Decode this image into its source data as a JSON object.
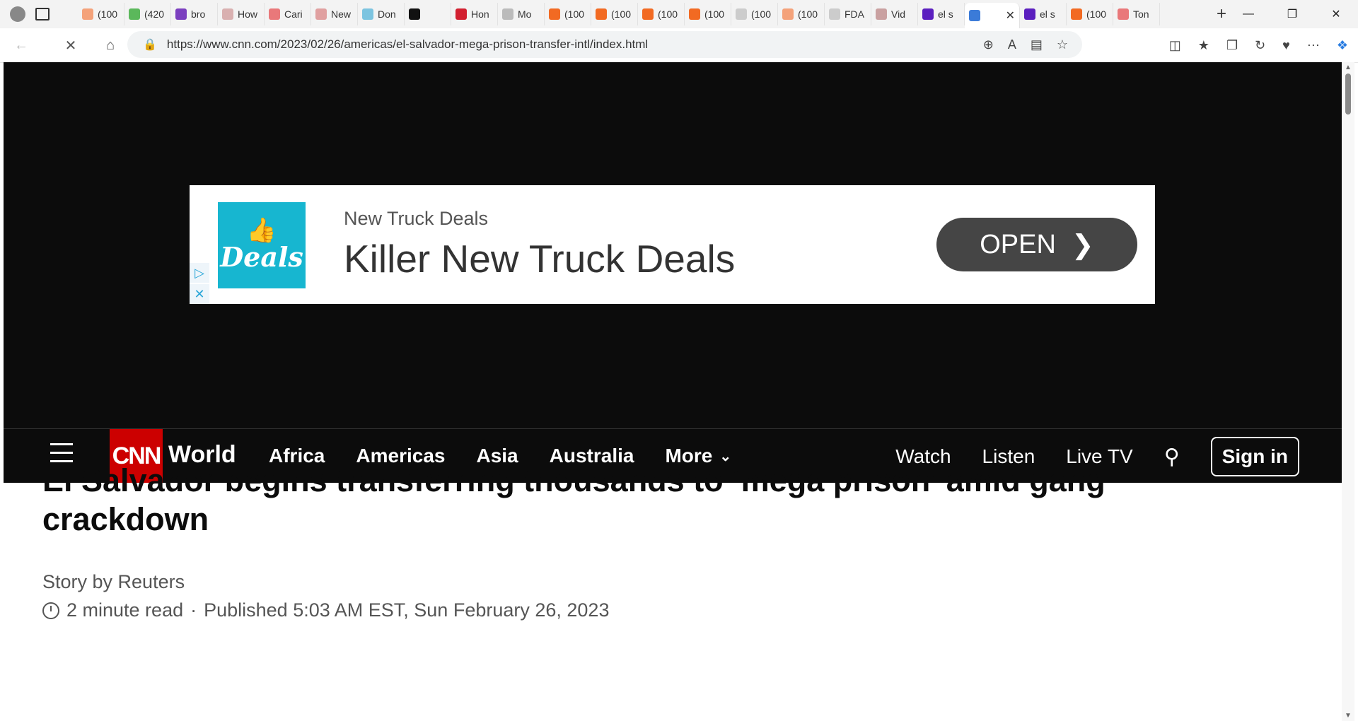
{
  "tabs": [
    {
      "label": "(100",
      "color": "#f4a27a"
    },
    {
      "label": "(420",
      "color": "#5bb85b"
    },
    {
      "label": "bro",
      "color": "#7b3fbf"
    },
    {
      "label": "How",
      "color": "#d9b0b0"
    },
    {
      "label": "Cari",
      "color": "#e9787a"
    },
    {
      "label": "New",
      "color": "#e0a0a0"
    },
    {
      "label": "Don",
      "color": "#7cc4e0"
    },
    {
      "label": "",
      "color": "#111111"
    },
    {
      "label": "Hon",
      "color": "#d22030"
    },
    {
      "label": "Mo",
      "color": "#bbbbbb"
    },
    {
      "label": "(100",
      "color": "#f26a22"
    },
    {
      "label": "(100",
      "color": "#f26a22"
    },
    {
      "label": "(100",
      "color": "#f26a22"
    },
    {
      "label": "(100",
      "color": "#f26a22"
    },
    {
      "label": "(100",
      "color": "#cccccc"
    },
    {
      "label": "(100",
      "color": "#f4a27a"
    },
    {
      "label": "FDA",
      "color": "#cccccc"
    },
    {
      "label": "Vid",
      "color": "#c9a0a0"
    },
    {
      "label": "el s",
      "color": "#5b1fbf"
    },
    {
      "label": "",
      "color": "#3b7bd8",
      "active": true
    },
    {
      "label": "el s",
      "color": "#5b1fbf"
    },
    {
      "label": "(100",
      "color": "#f26a22"
    },
    {
      "label": "Ton",
      "color": "#e9787a"
    }
  ],
  "address": {
    "url": "https://www.cnn.com/2023/02/26/americas/el-salvador-mega-prison-transfer-intl/index.html"
  },
  "ad": {
    "logo_text": "Deals",
    "subtitle": "New Truck Deals",
    "headline": "Killer New Truck Deals",
    "button_label": "OPEN"
  },
  "cnn_nav": {
    "logo": "CNN",
    "section": "World",
    "links": [
      "Africa",
      "Americas",
      "Asia",
      "Australia"
    ],
    "more_label": "More",
    "watch": "Watch",
    "listen": "Listen",
    "live_tv": "Live TV",
    "sign_in": "Sign in"
  },
  "article": {
    "headline": "El Salvador begins transferring thousands to ‘mega prison’ amid gang crackdown",
    "byline": "Story by Reuters",
    "read_time": "2 minute read",
    "separator": "·",
    "published": "Published 5:03 AM EST, Sun February 26, 2023"
  }
}
